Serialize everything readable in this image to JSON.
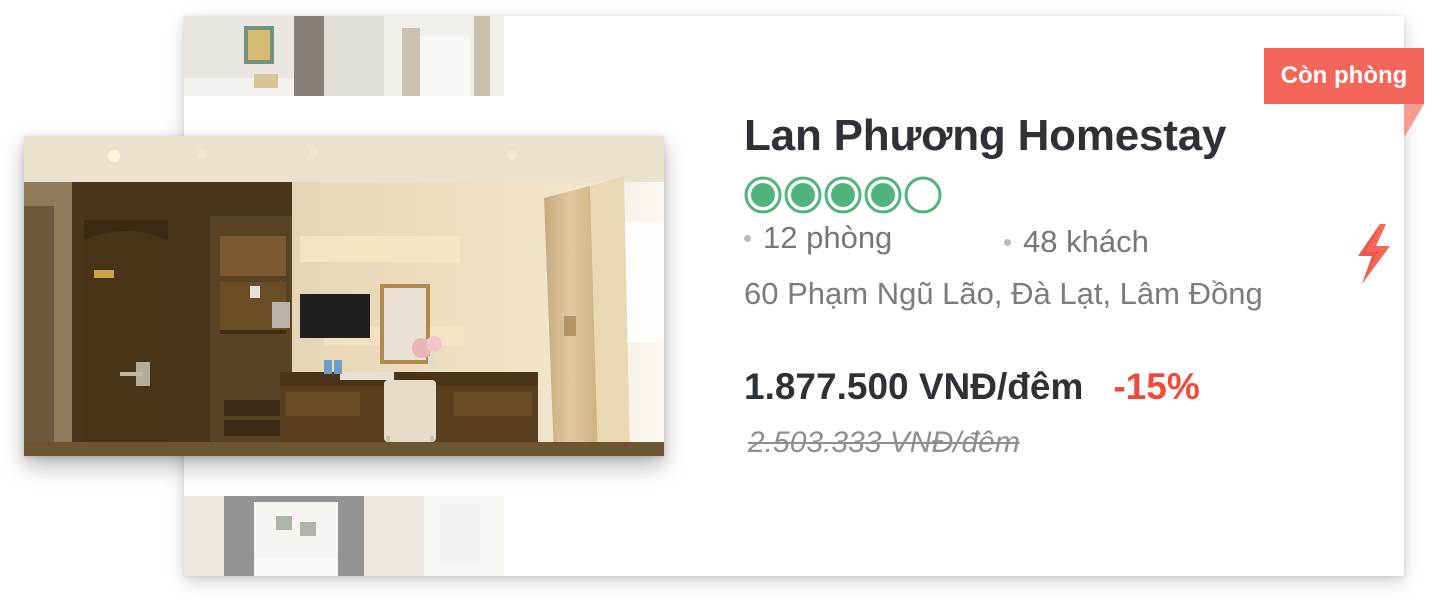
{
  "listing": {
    "name": "Lan Phương Homestay",
    "rating": {
      "value": 4,
      "max": 5
    },
    "rooms": "12 phòng",
    "guests": "48 khách",
    "address": "60 Phạm Ngũ Lão, Đà Lạt, Lâm Đồng",
    "price": "1.877.500 VNĐ/đêm",
    "discount": "-15%",
    "original_price": "2.503.333 VNĐ/đêm",
    "availability": "Còn phòng"
  },
  "icons": {
    "rating": "circle-rating-icon",
    "deal": "lightning-bolt-icon"
  },
  "colors": {
    "rating_green": "#4fb47b",
    "accent_red": "#f04a3c",
    "ribbon": "#f4665a",
    "text_dark": "#2e3135",
    "text_muted": "#7a7c80"
  }
}
